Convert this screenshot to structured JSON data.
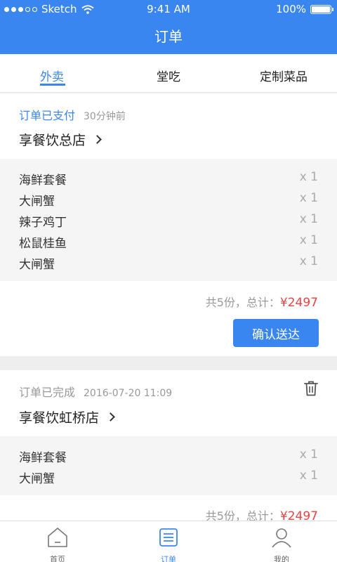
{
  "status_bar": {
    "carrier": "Sketch",
    "time": "9:41 AM",
    "battery": "100%"
  },
  "header": {
    "title": "订单"
  },
  "tabs": [
    {
      "label": "外卖",
      "active": true
    },
    {
      "label": "堂吃",
      "active": false
    },
    {
      "label": "定制菜品",
      "active": false
    }
  ],
  "orders": [
    {
      "status": "订单已支付",
      "status_color": "#3a86f0",
      "time": "30分钟前",
      "store": "享餐饮总店",
      "items": [
        {
          "name": "海鲜套餐",
          "qty": "x 1"
        },
        {
          "name": "大闸蟹",
          "qty": "x 1"
        },
        {
          "name": "辣子鸡丁",
          "qty": "x 1"
        },
        {
          "name": "松鼠桂鱼",
          "qty": "x 1"
        },
        {
          "name": "大闸蟹",
          "qty": "x 1"
        }
      ],
      "summary_prefix": "共5份，总计：",
      "total": "¥2497",
      "action": "确认送达"
    },
    {
      "status": "订单已完成",
      "status_color": "#999999",
      "time": "2016-07-20 11:09",
      "store": "享餐饮虹桥店",
      "items": [
        {
          "name": "海鲜套餐",
          "qty": "x 1"
        },
        {
          "name": "大闸蟹",
          "qty": "x 1"
        }
      ],
      "summary_prefix": "共5份，总计：",
      "total": "¥2497",
      "delete_icon": "trash-icon"
    }
  ],
  "tab_bar": [
    {
      "label": "首页",
      "icon": "home-icon",
      "active": false
    },
    {
      "label": "订单",
      "icon": "order-list-icon",
      "active": true
    },
    {
      "label": "我的",
      "icon": "user-icon",
      "active": false
    }
  ],
  "colors": {
    "primary": "#3a86f0",
    "price": "#f04141"
  }
}
